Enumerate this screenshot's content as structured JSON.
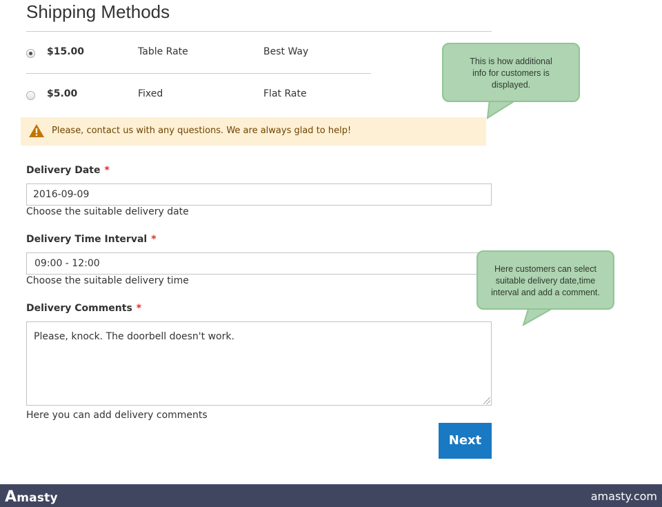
{
  "page": {
    "title": "Shipping Methods"
  },
  "shipping_methods": [
    {
      "price": "$15.00",
      "carrier": "Table Rate",
      "method": "Best Way",
      "selected": true
    },
    {
      "price": "$5.00",
      "carrier": "Fixed",
      "method": "Flat Rate",
      "selected": false
    }
  ],
  "notice": {
    "message": "Please, contact us with any questions. We are always glad to help!",
    "icon": "warning-icon"
  },
  "fields": {
    "delivery_date": {
      "label": "Delivery Date",
      "required_mark": "*",
      "value": "2016-09-09",
      "note": "Choose the suitable delivery date"
    },
    "delivery_time": {
      "label": "Delivery Time Interval",
      "required_mark": "*",
      "value": "09:00 - 12:00",
      "note": "Choose the suitable delivery time"
    },
    "delivery_comments": {
      "label": "Delivery Comments",
      "required_mark": "*",
      "value": "Please, knock. The doorbell doesn't work.",
      "note": "Here you can add delivery comments"
    }
  },
  "actions": {
    "next_label": "Next"
  },
  "callouts": {
    "info": {
      "line1": "This is how additional",
      "line2": "info for customers is",
      "line3": "displayed."
    },
    "delivery": {
      "line1": "Here customers can select",
      "line2": "suitable delivery date,time",
      "line3": "interval and add a comment."
    }
  },
  "footer": {
    "brand_initial": "A",
    "brand_rest": "masty",
    "site": "amasty.com"
  },
  "colors": {
    "accent": "#1979c3",
    "callout": "#aed4b1",
    "notice_bg": "#fdf0d5",
    "footer_bg": "#414660",
    "required": "#e02b27"
  }
}
